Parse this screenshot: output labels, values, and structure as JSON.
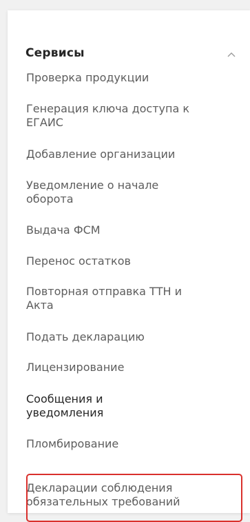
{
  "sidebar": {
    "section_title": "Сервисы",
    "collapse_icon": "chevron-up-icon",
    "items": [
      {
        "label": "Проверка продукции"
      },
      {
        "label": "Генерация ключа доступа к ЕГАИС"
      },
      {
        "label": "Добавление организации"
      },
      {
        "label": "Уведомление о начале оборота"
      },
      {
        "label": "Выдача ФСМ"
      },
      {
        "label": "Перенос остатков"
      },
      {
        "label": "Повторная отправка ТТН и Акта"
      },
      {
        "label": "Подать декларацию"
      },
      {
        "label": "Лицензирование"
      },
      {
        "label": "Сообщения и уведомления"
      },
      {
        "label": "Пломбирование"
      },
      {
        "label": "Декларации соблюдения обязательных требований"
      }
    ],
    "active_item": "Сообщения и уведомления",
    "highlighted_item": "Декларации соблюдения обязательных требований"
  },
  "colors": {
    "page_background": "#f1f1f1",
    "panel_background": "#ffffff",
    "title_text": "#252525",
    "item_text": "#5d5d5d",
    "highlight_border": "#d9302c"
  }
}
